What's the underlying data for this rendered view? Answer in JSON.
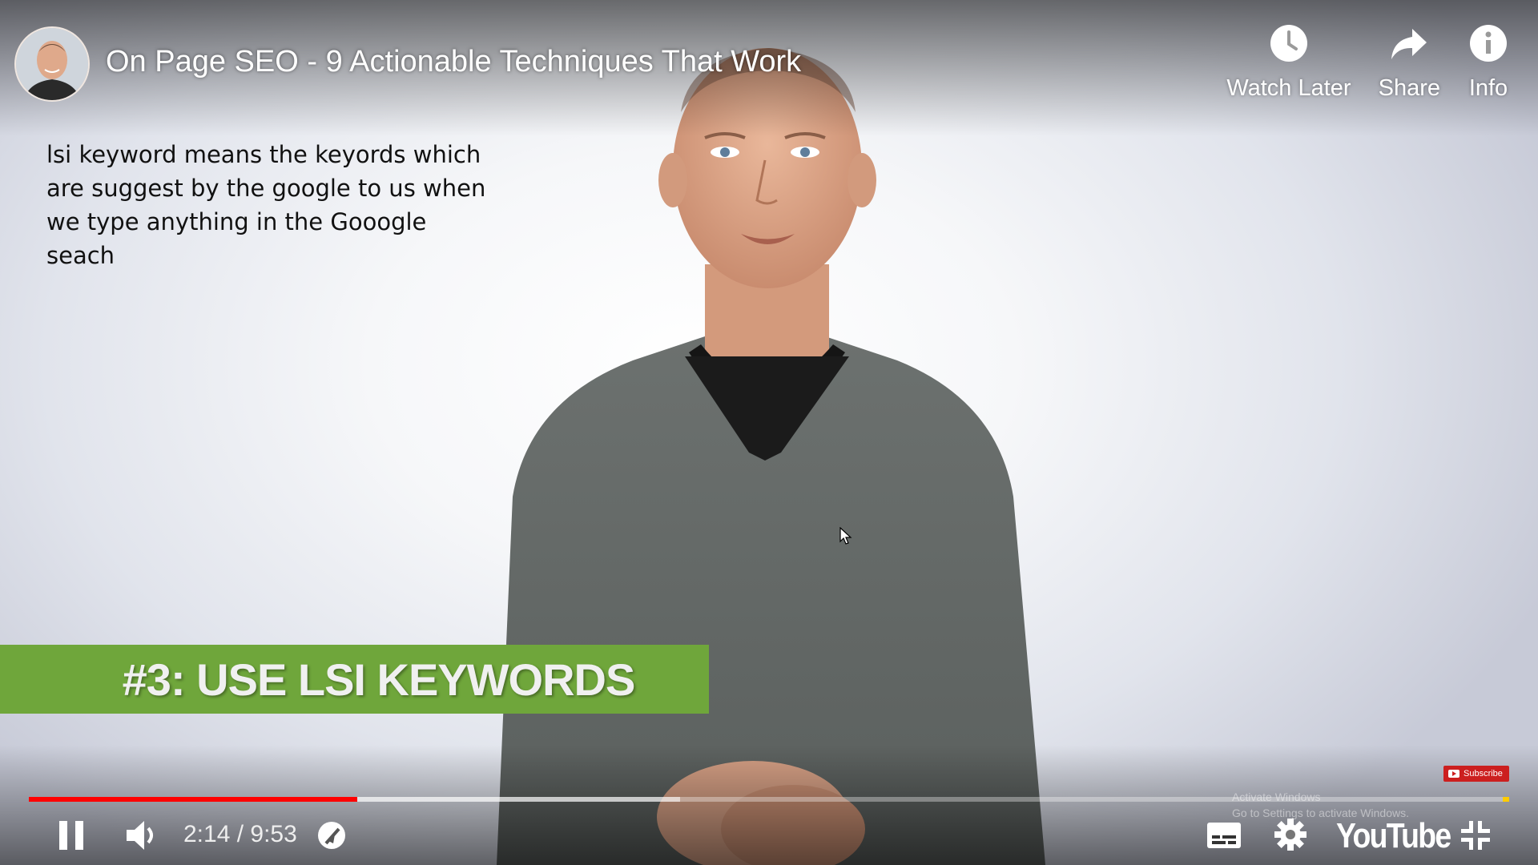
{
  "video": {
    "title": "On Page SEO - 9 Actionable Techniques That Work",
    "annotation": "lsi keyword means the keyords which are suggest by the google to us when we type anything in the Gooogle seach",
    "lower_third": "#3: USE LSI KEYWORDS"
  },
  "top_actions": {
    "watch_later": "Watch Later",
    "share": "Share",
    "info": "Info"
  },
  "subscribe_badge": "Subscribe",
  "watermark": {
    "line1": "Activate Windows",
    "line2": "Go to Settings to activate Windows."
  },
  "player": {
    "current_time": "2:14",
    "separator": " / ",
    "duration": "9:53",
    "played_fraction": 0.222,
    "buffered_fraction": 0.44,
    "brand": "YouTube"
  },
  "icons": {
    "watch_later": "clock-icon",
    "share": "share-arrow-icon",
    "info": "info-icon",
    "pause": "pause-icon",
    "volume": "volume-icon",
    "autoplay": "autoplay-toggle-icon",
    "captions": "captions-icon",
    "settings": "gear-icon",
    "fullscreen_exit": "exit-fullscreen-icon"
  },
  "colors": {
    "progress_played": "#ff0000",
    "lower_third_bg": "#6fa63b",
    "subscribe_bg": "#cc1f1f"
  }
}
